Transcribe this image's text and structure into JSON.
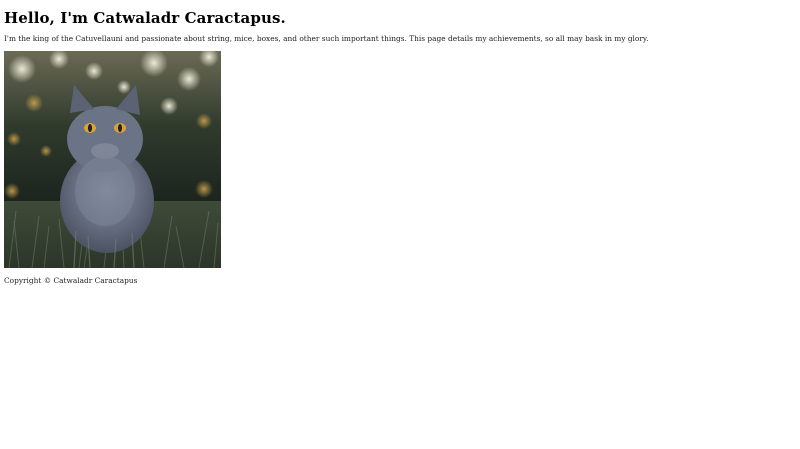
{
  "header": {
    "title": "Hello, I'm Catwaladr Caractapus."
  },
  "intro": {
    "text": "I'm the king of the Catuvellauni and passionate about string, mice, boxes, and other such important things. This page details my achievements, so all may bask in my glory."
  },
  "photo": {
    "subject": "grey cat sitting in grass"
  },
  "footer": {
    "copyright": "Copyright © Catwaladr Caractapus"
  }
}
